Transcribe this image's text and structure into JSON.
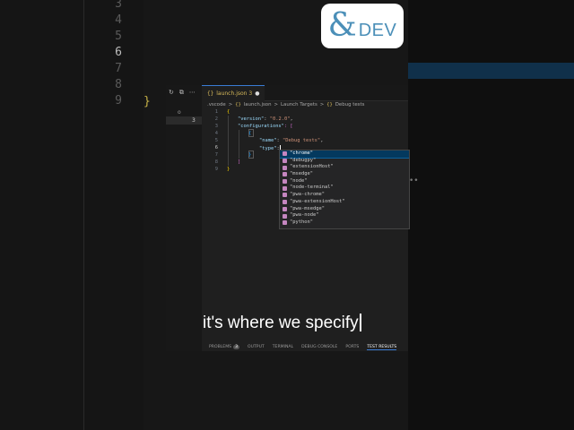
{
  "background": {
    "line_numbers": [
      "3",
      "4",
      "5",
      "6",
      "7",
      "8",
      "9"
    ],
    "active_line": "6",
    "brace": "}"
  },
  "logo": {
    "amp": "&",
    "text": "DEV"
  },
  "activity": {
    "icons": [
      "↻",
      "⧉",
      "⋯"
    ],
    "badge": "o",
    "selected_number": "3"
  },
  "tab": {
    "icon": "{}",
    "label": "launch.json 3",
    "modified": "●"
  },
  "breadcrumb": {
    "items": [
      ".vscode",
      ">",
      "{}",
      "launch.json",
      ">",
      "Launch Targets",
      ">",
      "{}",
      "Debug tests"
    ]
  },
  "code": {
    "line_numbers": [
      "1",
      "2",
      "3",
      "4",
      "5",
      "6",
      "7",
      "8",
      "9"
    ],
    "lines": {
      "l1_open": "{",
      "l2_key": "\"version\"",
      "l2_colon": ": ",
      "l2_val": "\"0.2.0\"",
      "l2_comma": ",",
      "l3_key": "\"configurations\"",
      "l3_rest": ": [",
      "l4_open": "{",
      "l5_key": "\"name\"",
      "l5_colon": ": ",
      "l5_val": "\"Debug tests\"",
      "l5_comma": ",",
      "l6_key": "\"type\"",
      "l6_colon": ":",
      "l7_close": "}",
      "l8_close": "]",
      "l9_close": "}"
    }
  },
  "suggestions": {
    "items": [
      "\"chrome\"",
      "\"debugpy\"",
      "\"extensionHost\"",
      "\"msedge\"",
      "\"node\"",
      "\"node-terminal\"",
      "\"pwa-chrome\"",
      "\"pwa-extensionHost\"",
      "\"pwa-msedge\"",
      "\"pwa-node\"",
      "\"python\""
    ],
    "selected_index": 0
  },
  "caption": {
    "text": "it's where we specify"
  },
  "panel": {
    "tabs": [
      "PROBLEMS",
      "OUTPUT",
      "TERMINAL",
      "DEBUG CONSOLE",
      "PORTS",
      "TEST RESULTS"
    ],
    "problems_badge": "3",
    "active": "TEST RESULTS"
  },
  "colors": {
    "accent": "#3a7bd5",
    "string": "#ce9178",
    "key": "#9cdcfe",
    "selection": "#04395e"
  }
}
